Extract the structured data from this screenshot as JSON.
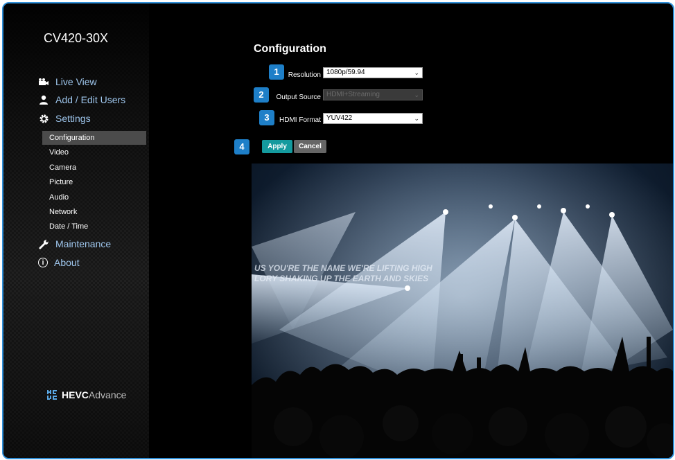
{
  "app": {
    "model": "CV420-30X",
    "page_title": "Configuration"
  },
  "sidebar": {
    "main_items": [
      {
        "label": "Live View",
        "icon": "camera-icon"
      },
      {
        "label": "Add / Edit Users",
        "icon": "user-icon"
      },
      {
        "label": "Settings",
        "icon": "gear-icon"
      },
      {
        "label": "Maintenance",
        "icon": "wrench-icon"
      },
      {
        "label": "About",
        "icon": "info-icon"
      }
    ],
    "settings_items": [
      "Configuration",
      "Video",
      "Camera",
      "Picture",
      "Audio",
      "Network",
      "Date / Time"
    ],
    "active_item": "Configuration",
    "logo": {
      "mark": "HE\nVC",
      "bold": "HEVC",
      "thin": "Advance"
    }
  },
  "form": {
    "resolution": {
      "badge": "1",
      "label": "Resolution",
      "value": "1080p/59.94"
    },
    "output_source": {
      "badge": "2",
      "label": "Output Source",
      "value": "HDMI+Streaming",
      "disabled": true
    },
    "hdmi_format": {
      "badge": "3",
      "label": "HDMI Format",
      "value": "YUV422"
    },
    "buttons_badge": "4",
    "apply_label": "Apply",
    "cancel_label": "Cancel"
  },
  "preview": {
    "overlay_line1": "US YOU'RE THE NAME WE'RE LIFTING HIGH",
    "overlay_line2": "LORY SHAKING UP THE EARTH AND SKIES"
  },
  "colors": {
    "frame_border": "#2f8fd8",
    "badge": "#1e7fc8",
    "apply": "#149a9e",
    "nav_text": "#9fc7ee"
  }
}
